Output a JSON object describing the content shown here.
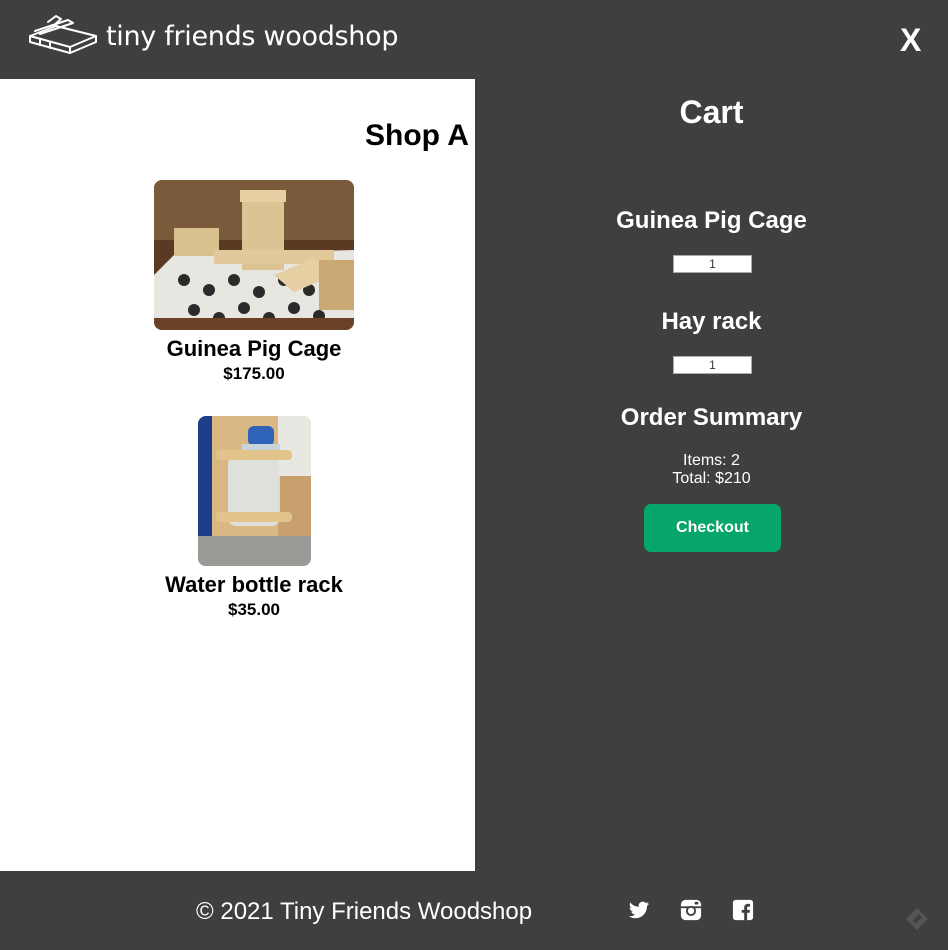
{
  "header": {
    "brand": "tiny friends woodshop",
    "close_label": "X"
  },
  "main": {
    "title": "Shop A",
    "products": [
      {
        "name": "Guinea Pig Cage",
        "price": "$175.00",
        "image": "guinea-pig-cage-photo"
      },
      {
        "name": "Water bottle rack",
        "price": "$35.00",
        "image": "water-bottle-rack-photo"
      }
    ]
  },
  "cart": {
    "title": "Cart",
    "items": [
      {
        "name": "Guinea Pig Cage",
        "quantity": "1"
      },
      {
        "name": "Hay rack",
        "quantity": "1"
      }
    ],
    "summary": {
      "title": "Order Summary",
      "items_text": "Items: 2",
      "total_text": "Total: $210"
    },
    "checkout_label": "Checkout"
  },
  "footer": {
    "copyright": "© 2021 Tiny Friends Woodshop",
    "social": [
      "twitter-icon",
      "instagram-icon",
      "facebook-icon"
    ]
  },
  "colors": {
    "header_bg": "#3f3f3f",
    "checkout_green": "#06a56b"
  }
}
